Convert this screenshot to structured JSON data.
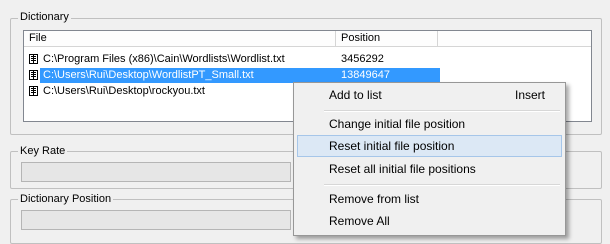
{
  "dictionary": {
    "label": "Dictionary",
    "columns": {
      "file": "File",
      "position": "Position"
    },
    "rows": [
      {
        "file": "C:\\Program Files (x86)\\Cain\\Wordlists\\Wordlist.txt",
        "position": "3456292",
        "selected": false
      },
      {
        "file": "C:\\Users\\Rui\\Desktop\\WordlistPT_Small.txt",
        "position": "13849647",
        "selected": true
      },
      {
        "file": "C:\\Users\\Rui\\Desktop\\rockyou.txt",
        "position": "",
        "selected": false
      }
    ],
    "row_icon": "file-list-icon"
  },
  "key_rate": {
    "label": "Key Rate"
  },
  "dictionary_position": {
    "label": "Dictionary Position"
  },
  "context_menu": {
    "items": [
      {
        "label": "Add to list",
        "shortcut": "Insert"
      },
      {
        "label": "Change initial file position"
      },
      {
        "label": "Reset initial file position",
        "highlighted": true
      },
      {
        "label": "Reset all initial file positions"
      },
      {
        "label": "Remove from list"
      },
      {
        "label": "Remove All"
      }
    ]
  }
}
